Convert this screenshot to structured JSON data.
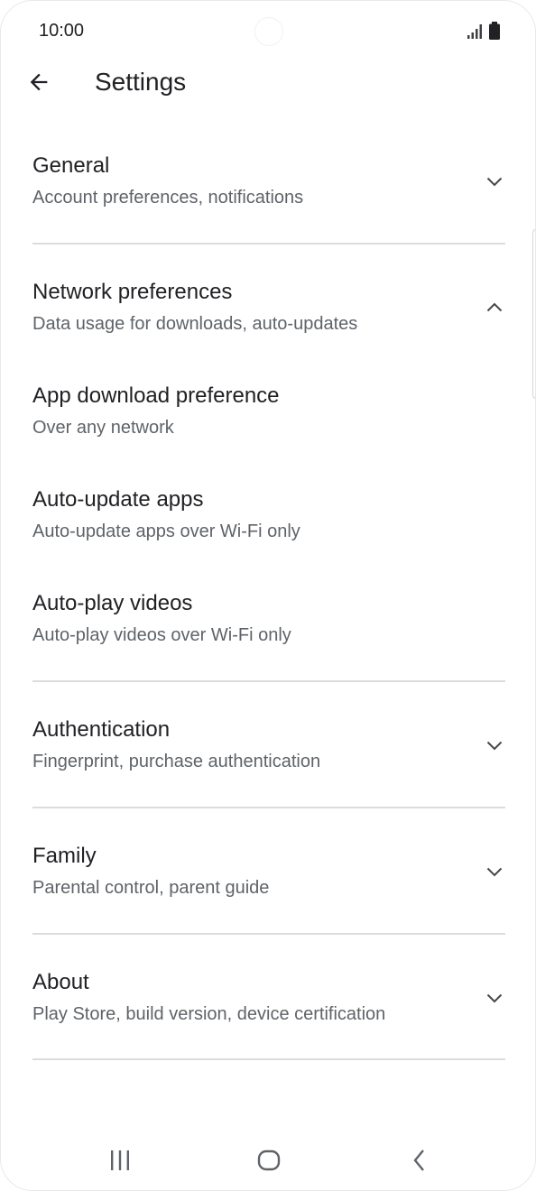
{
  "status_bar": {
    "time": "10:00",
    "icons": [
      "signal-icon",
      "battery-icon"
    ]
  },
  "header": {
    "back_icon": "arrow-back-icon",
    "title": "Settings"
  },
  "sections": {
    "general": {
      "title": "General",
      "subtitle": "Account preferences, notifications",
      "expanded": false
    },
    "network": {
      "title": "Network preferences",
      "subtitle": "Data usage for downloads, auto-updates",
      "expanded": true,
      "items": [
        {
          "title": "App download preference",
          "subtitle": "Over any network"
        },
        {
          "title": "Auto-update apps",
          "subtitle": "Auto-update apps over Wi-Fi only"
        },
        {
          "title": "Auto-play videos",
          "subtitle": "Auto-play videos over Wi-Fi only"
        }
      ]
    },
    "authentication": {
      "title": "Authentication",
      "subtitle": "Fingerprint, purchase authentication",
      "expanded": false
    },
    "family": {
      "title": "Family",
      "subtitle": "Parental control, parent guide",
      "expanded": false
    },
    "about": {
      "title": "About",
      "subtitle": "Play Store, build version, device certification",
      "expanded": false
    }
  },
  "nav_bar": {
    "icons": [
      "recents-icon",
      "home-icon",
      "back-icon"
    ]
  },
  "colors": {
    "primary_text": "#202124",
    "secondary_text": "#5f6368",
    "divider": "#dadce0",
    "icon": "#444746"
  }
}
